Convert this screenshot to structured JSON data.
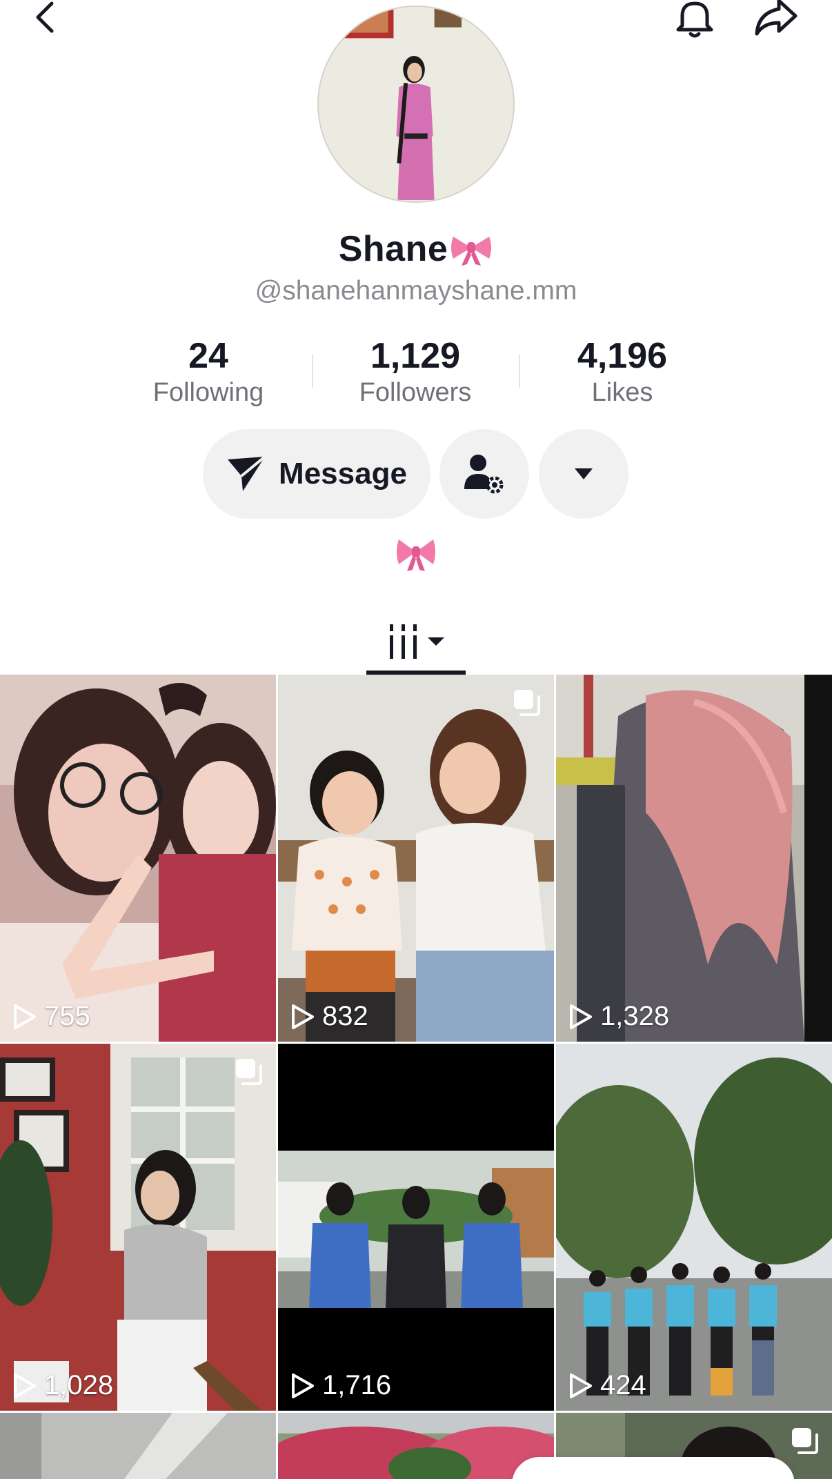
{
  "header": {
    "back_icon": "chevron-left-icon",
    "bell_icon": "bell-icon",
    "share_icon": "share-arrow-icon"
  },
  "profile": {
    "display_name": "Shane",
    "name_emoji_icon": "pink-bow-icon",
    "handle": "@shanehanmayshane.mm",
    "bio_icon": "pink-bow-icon"
  },
  "stats": {
    "following": {
      "value": "24",
      "label": "Following"
    },
    "followers": {
      "value": "1,129",
      "label": "Followers"
    },
    "likes": {
      "value": "4,196",
      "label": "Likes"
    }
  },
  "actions": {
    "message_label": "Message",
    "message_icon": "send-icon",
    "friend_settings_icon": "person-gear-icon",
    "more_icon": "caret-down-icon"
  },
  "tabs": {
    "videos_icon": "grid-columns-icon",
    "dropdown_icon": "caret-down-icon"
  },
  "videos": [
    {
      "views": "755",
      "multi": false
    },
    {
      "views": "832",
      "multi": true
    },
    {
      "views": "1,328",
      "multi": false
    },
    {
      "views": "1,028",
      "multi": true
    },
    {
      "views": "1,716",
      "multi": false
    },
    {
      "views": "424",
      "multi": false
    },
    {
      "views": "",
      "multi": false
    },
    {
      "views": "",
      "multi": false
    },
    {
      "views": "",
      "multi": true
    }
  ],
  "colors": {
    "text_primary": "#161823",
    "text_secondary": "#8a8b91",
    "button_bg": "#f1f1f2",
    "bow_pink": "#f27aa8"
  }
}
